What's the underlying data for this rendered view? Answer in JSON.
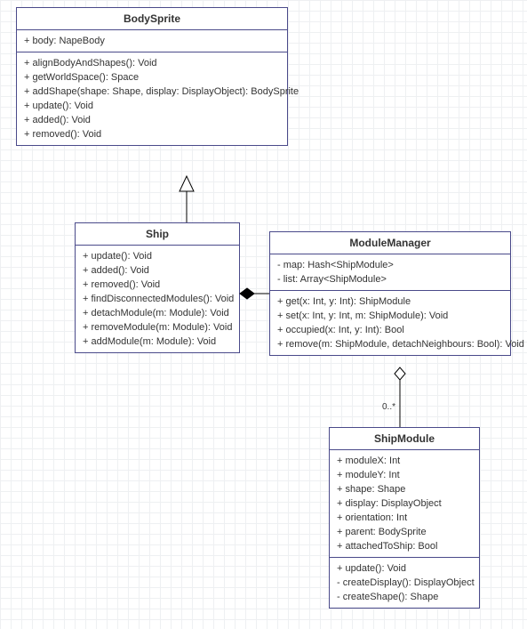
{
  "classes": {
    "bodySprite": {
      "name": "BodySprite",
      "attributes": [
        "+ body: NapeBody"
      ],
      "operations": [
        "+ alignBodyAndShapes(): Void",
        "+ getWorldSpace(): Space",
        "+ addShape(shape: Shape, display: DisplayObject): BodySprite",
        "+ update(): Void",
        "+ added(): Void",
        "+ removed(): Void"
      ]
    },
    "ship": {
      "name": "Ship",
      "operations": [
        "+ update(): Void",
        "+ added(): Void",
        "+ removed(): Void",
        "+ findDisconnectedModules(): Void",
        "+ detachModule(m: Module): Void",
        "+ removeModule(m: Module): Void",
        "+ addModule(m: Module): Void"
      ]
    },
    "moduleManager": {
      "name": "ModuleManager",
      "attributes": [
        "- map: Hash<ShipModule>",
        "- list: Array<ShipModule>"
      ],
      "operations": [
        "+ get(x: Int, y: Int): ShipModule",
        "+ set(x: Int, y: Int, m: ShipModule): Void",
        "+ occupied(x: Int, y: Int): Bool",
        "+ remove(m: ShipModule, detachNeighbours: Bool): Void"
      ]
    },
    "shipModule": {
      "name": "ShipModule",
      "attributes": [
        "+ moduleX: Int",
        "+ moduleY: Int",
        "+ shape: Shape",
        "+ display: DisplayObject",
        "+ orientation: Int",
        "+ parent: BodySprite",
        "+ attachedToShip: Bool"
      ],
      "operations": [
        "+ update(): Void",
        "- createDisplay(): DisplayObject",
        "- createShape(): Shape"
      ]
    }
  },
  "multiplicity": {
    "shipModule_end": "0..*"
  },
  "chart_data": {
    "type": "uml-class-diagram",
    "classes": [
      {
        "name": "BodySprite",
        "attributes": [
          "+ body: NapeBody"
        ],
        "operations": [
          "+ alignBodyAndShapes(): Void",
          "+ getWorldSpace(): Space",
          "+ addShape(shape: Shape, display: DisplayObject): BodySprite",
          "+ update(): Void",
          "+ added(): Void",
          "+ removed(): Void"
        ]
      },
      {
        "name": "Ship",
        "attributes": [],
        "operations": [
          "+ update(): Void",
          "+ added(): Void",
          "+ removed(): Void",
          "+ findDisconnectedModules(): Void",
          "+ detachModule(m: Module): Void",
          "+ removeModule(m: Module): Void",
          "+ addModule(m: Module): Void"
        ]
      },
      {
        "name": "ModuleManager",
        "attributes": [
          "- map: Hash<ShipModule>",
          "- list: Array<ShipModule>"
        ],
        "operations": [
          "+ get(x: Int, y: Int): ShipModule",
          "+ set(x: Int, y: Int, m: ShipModule): Void",
          "+ occupied(x: Int, y: Int): Bool",
          "+ remove(m: ShipModule, detachNeighbours: Bool): Void"
        ]
      },
      {
        "name": "ShipModule",
        "attributes": [
          "+ moduleX: Int",
          "+ moduleY: Int",
          "+ shape: Shape",
          "+ display: DisplayObject",
          "+ orientation: Int",
          "+ parent: BodySprite",
          "+ attachedToShip: Bool"
        ],
        "operations": [
          "+ update(): Void",
          "- createDisplay(): DisplayObject",
          "- createShape(): Shape"
        ]
      }
    ],
    "relationships": [
      {
        "type": "generalization",
        "from": "Ship",
        "to": "BodySprite"
      },
      {
        "type": "composition",
        "from": "Ship",
        "to": "ModuleManager"
      },
      {
        "type": "aggregation",
        "from": "ModuleManager",
        "to": "ShipModule",
        "multiplicity_to": "0..*"
      }
    ]
  }
}
